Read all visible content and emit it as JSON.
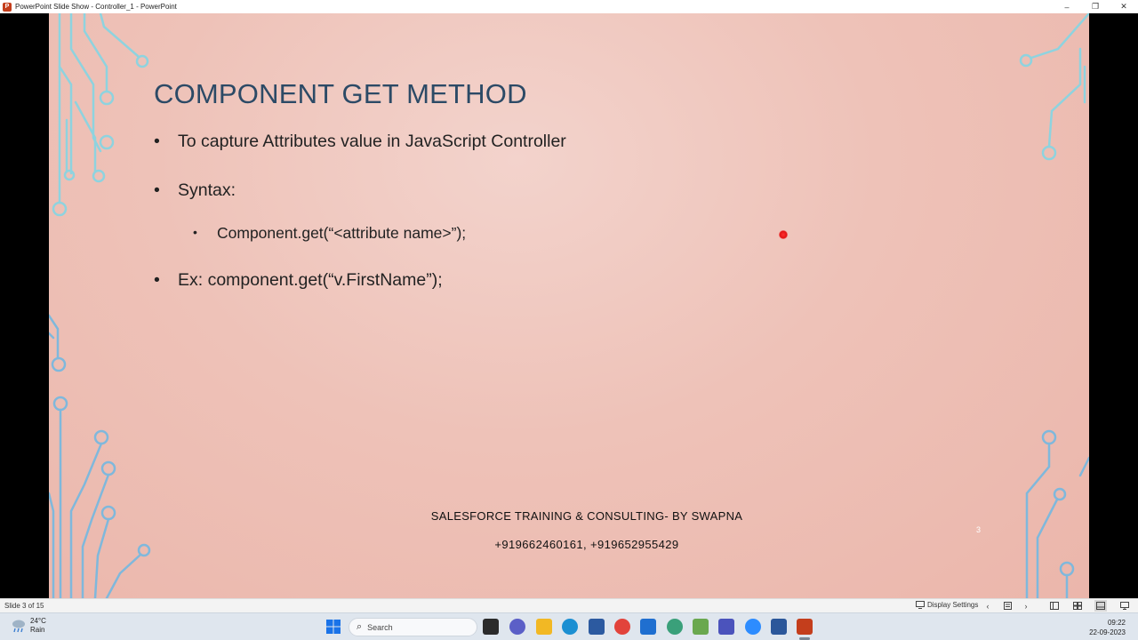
{
  "window": {
    "title": "PowerPoint Slide Show  -  Controller_1 - PowerPoint",
    "app_icon": "P",
    "minimize": "–",
    "restore": "❐",
    "close": "✕"
  },
  "slide": {
    "title": "COMPONENT GET METHOD",
    "bullets": [
      {
        "text": "To capture Attributes value in JavaScript Controller",
        "level": 1
      },
      {
        "text": "Syntax:",
        "level": 1
      },
      {
        "text": "Component.get(“<attribute name>”);",
        "level": 2
      },
      {
        "text": "Ex: component.get(“v.FirstName”);",
        "level": 1
      }
    ],
    "bullet_glyph": "•",
    "footer_line1": "SALESFORCE TRAINING & CONSULTING- BY SWAPNA",
    "footer_line2": "+919662460161, +919652955429",
    "slide_number": "3",
    "colors": {
      "title": "#2c4a66",
      "circuit": "#8ed3df",
      "background": "#eec2b8"
    }
  },
  "statusbar": {
    "slide_info": "Slide 3 of 15",
    "display_settings": "Display Settings",
    "prev": "‹",
    "next": "›"
  },
  "taskbar": {
    "weather_temp": "24°C",
    "weather_desc": "Rain",
    "search_placeholder": "Search",
    "time": "09:22",
    "date": "22-09-2023"
  }
}
